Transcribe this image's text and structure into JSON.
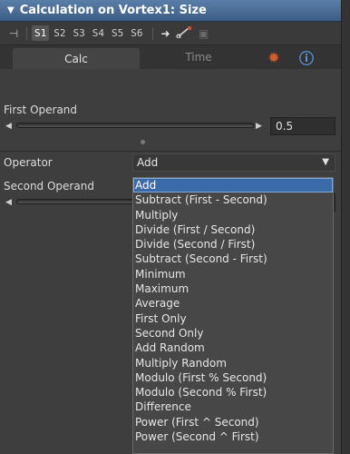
{
  "window": {
    "title": "Calculation on Vortex1: Size",
    "collapse_icon": "triangle-down-icon"
  },
  "toolbar": {
    "pin_icon": "pin-icon",
    "slots": [
      "S1",
      "S2",
      "S3",
      "S4",
      "S5",
      "S6"
    ],
    "active_slot": "S1",
    "icons": [
      "arrow-right-icon",
      "connect-icon",
      "save-icon"
    ]
  },
  "tabs": [
    {
      "label": "Calc",
      "active": true
    },
    {
      "label": "Time",
      "active": false
    }
  ],
  "tab_icons": [
    "gear-icon",
    "info-icon"
  ],
  "first_operand": {
    "label": "First Operand",
    "value": "0.5"
  },
  "operator": {
    "label": "Operator",
    "selected": "Add"
  },
  "second_operand": {
    "label": "Second Operand"
  },
  "operator_options": [
    "Add",
    "Subtract (First - Second)",
    "Multiply",
    "Divide  (First / Second)",
    "Divide  (Second / First)",
    "Subtract (Second - First)",
    "Minimum",
    "Maximum",
    "Average",
    "First Only",
    "Second Only",
    "Add Random",
    "Multiply Random",
    "Modulo (First % Second)",
    "Modulo (Second % First)",
    "Difference",
    "Power (First ^ Second)",
    "Power (Second ^ First)"
  ],
  "colors": {
    "title_bar": "#4a6d96",
    "selection": "#3b6aa8",
    "gear": "#d35c2e",
    "info": "#5aa0e8"
  }
}
